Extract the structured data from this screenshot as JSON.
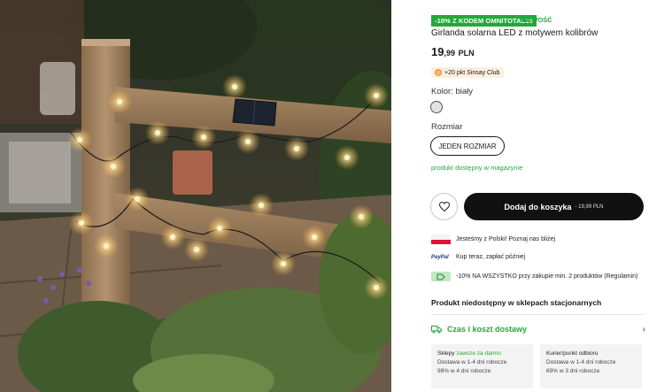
{
  "product": {
    "promo_badge": "-10% Z KODEM OMNITOTAL10",
    "new_badge": "NOWOŚĆ",
    "title": "Girlanda solarna LED z motywem kolibrów",
    "price_main": "19",
    "price_decimal": ",99",
    "currency": "PLN",
    "club_points": "+20 pkt Sinsay Club",
    "color_label": "Kolor: biały",
    "size_label": "Rozmiar",
    "size_option": "JEDEN ROZMIAR",
    "stock_status": "produkt dostępny w magazynie",
    "add_to_cart": "Dodaj do koszyka",
    "add_to_cart_price": "- 19,99 PLN"
  },
  "info": [
    {
      "icon": "poland-flag-icon",
      "text": "Jesteśmy z Polski! Poznaj nas bliżej"
    },
    {
      "icon": "paypal-icon",
      "icon_text": "PayPal",
      "text": "Kup teraz, zapłać później"
    },
    {
      "icon": "discount-tag-icon",
      "text": "-10% NA WSZYSTKO przy zakupie min. 2 produktów (Regulamin)"
    }
  ],
  "unavailable": "Produkt niedostępny w sklepach stacjonarnych",
  "delivery": {
    "title": "Czas i koszt dostawy",
    "stores": {
      "title": "Sklepy",
      "free": "zawsze za darmo",
      "line1": "Dostawa w 1-4 dni robocze",
      "line2": "98% w 4 dni robocze"
    },
    "courier": {
      "title": "Kurier/punkt odbioru",
      "line1": "Dostawa w 1-4 dni robocze",
      "line2": "69% w 3 dni robocze"
    }
  },
  "colors": {
    "accent_green": "#22a83a",
    "button_dark": "#111111",
    "flag_red": "#dc143c"
  }
}
